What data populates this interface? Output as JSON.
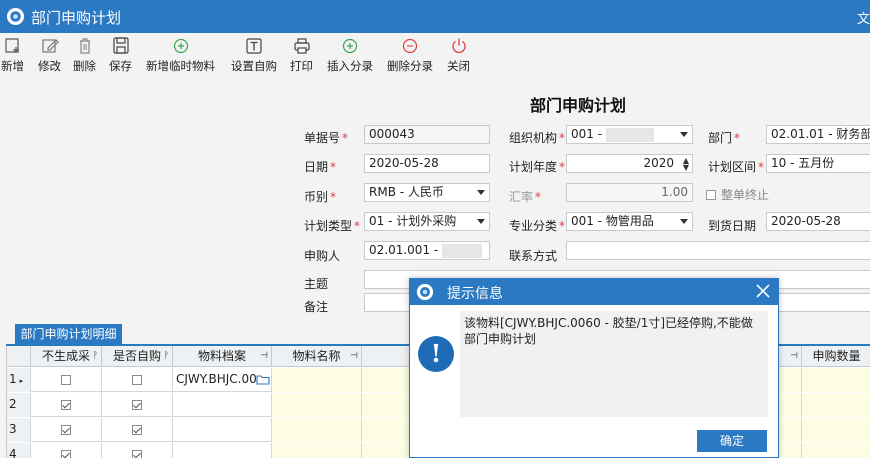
{
  "window": {
    "title": "部门申购计划",
    "right_text": "文"
  },
  "toolbar": [
    {
      "key": "new",
      "label": "新增",
      "icon": "new-icon"
    },
    {
      "key": "edit",
      "label": "修改",
      "icon": "edit-icon"
    },
    {
      "key": "delete",
      "label": "删除",
      "icon": "trash-icon"
    },
    {
      "key": "save",
      "label": "保存",
      "icon": "save-icon"
    },
    {
      "key": "add_temp",
      "label": "新增临时物料",
      "icon": "plus-circle-icon"
    },
    {
      "key": "set_self",
      "label": "设置自购",
      "icon": "text-box-icon"
    },
    {
      "key": "print",
      "label": "打印",
      "icon": "printer-icon"
    },
    {
      "key": "insert_split",
      "label": "插入分录",
      "icon": "plus-circle-icon"
    },
    {
      "key": "delete_split",
      "label": "删除分录",
      "icon": "minus-circle-icon"
    },
    {
      "key": "close",
      "label": "关闭",
      "icon": "power-icon"
    }
  ],
  "form": {
    "title": "部门申购计划",
    "doc_no": {
      "label": "单据号",
      "value": "000043"
    },
    "org": {
      "label": "组织机构",
      "value": "001 -"
    },
    "dept": {
      "label": "部门",
      "value": "02.01.01 - 财务部"
    },
    "date": {
      "label": "日期",
      "value": "2020-05-28"
    },
    "plan_year": {
      "label": "计划年度",
      "value": "2020"
    },
    "plan_period": {
      "label": "计划区间",
      "value": "10 - 五月份"
    },
    "currency": {
      "label": "币别",
      "value": "RMB - 人民币"
    },
    "rate": {
      "label": "汇率",
      "value": "1.00"
    },
    "whole_stop": {
      "label": "整单终止"
    },
    "plan_type": {
      "label": "计划类型",
      "value": "01 - 计划外采购"
    },
    "category": {
      "label": "专业分类",
      "value": "001 - 物管用品"
    },
    "arrival": {
      "label": "到货日期",
      "value": "2020-05-28"
    },
    "applicant": {
      "label": "申购人",
      "value": "02.01.001 -"
    },
    "contact": {
      "label": "联系方式",
      "value": ""
    },
    "subject": {
      "label": "主题",
      "value": ""
    },
    "remark": {
      "label": "备注",
      "value": ""
    }
  },
  "grid": {
    "tab_label": "部门申购计划明细",
    "columns": [
      "不生成采",
      "是否自购",
      "物料档案",
      "物料名称",
      "申购数量"
    ],
    "rows": [
      {
        "n": "1",
        "no_purchase": false,
        "self_buy": false,
        "material": "CJWY.BHJC.00"
      },
      {
        "n": "2",
        "no_purchase": true,
        "self_buy": true,
        "material": ""
      },
      {
        "n": "3",
        "no_purchase": true,
        "self_buy": true,
        "material": ""
      },
      {
        "n": "4",
        "no_purchase": true,
        "self_buy": true,
        "material": ""
      }
    ]
  },
  "dialog": {
    "title": "提示信息",
    "message": "该物料[CJWY.BHJC.0060  -  胶垫/1寸]已经停购,不能做部门申购计划",
    "ok_label": "确定"
  },
  "colors": {
    "accent": "#2b79c2",
    "required": "#e23b3b",
    "editable_cell": "#fdfde3",
    "toolbar_icon_green": "#3aa655",
    "toolbar_icon_red": "#e04040"
  }
}
